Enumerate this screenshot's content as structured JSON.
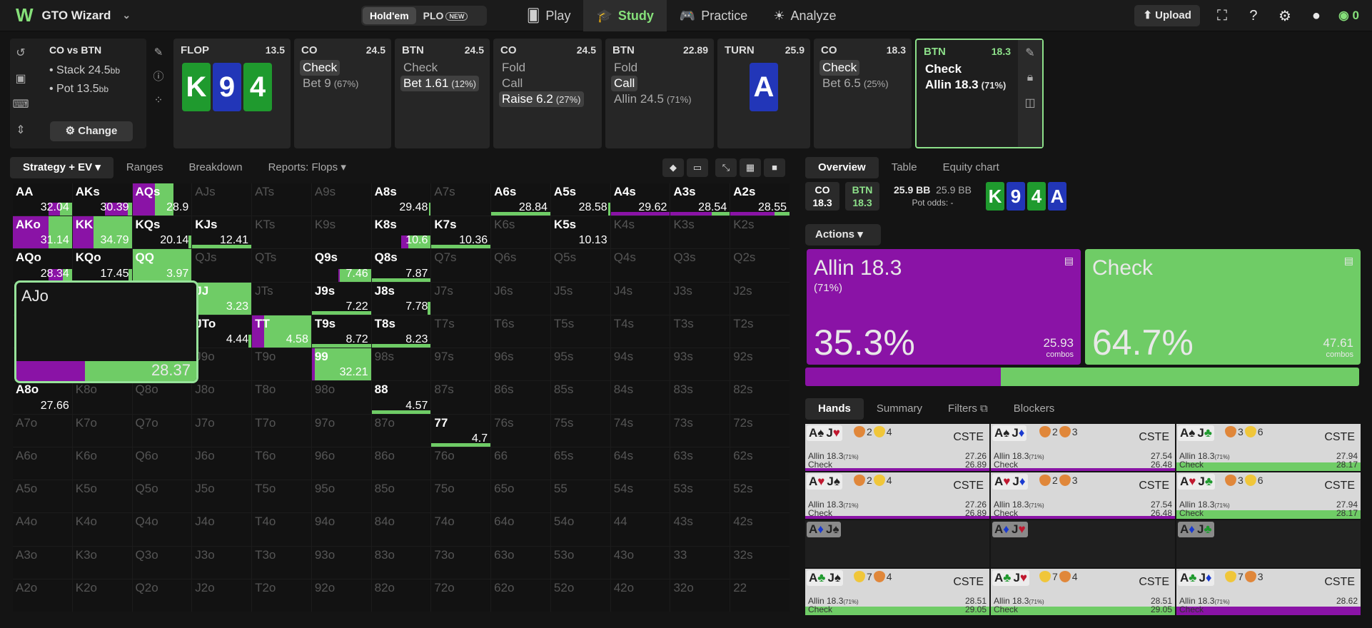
{
  "app": {
    "name": "GTO Wizard",
    "modes": [
      "Hold'em",
      "PLO"
    ],
    "new_badge": "NEW",
    "nav": [
      {
        "label": "Play",
        "icon": "cards-icon"
      },
      {
        "label": "Study",
        "icon": "graduation-icon"
      },
      {
        "label": "Practice",
        "icon": "gamepad-icon"
      },
      {
        "label": "Analyze",
        "icon": "lightbulb-icon"
      }
    ],
    "upload": "Upload",
    "coins": "0"
  },
  "scenario": {
    "title": "CO vs BTN",
    "stack": "Stack 24.5",
    "pot": "Pot 13.5",
    "bb": "bb",
    "change": "Change"
  },
  "tiles": [
    {
      "name": "FLOP",
      "val": "13.5",
      "cards": [
        {
          "r": "K",
          "c": "g"
        },
        {
          "r": "9",
          "c": "b"
        },
        {
          "r": "4",
          "c": "g"
        }
      ]
    },
    {
      "name": "CO",
      "val": "24.5",
      "actions": [
        {
          "t": "Check",
          "p": "",
          "s": "hl"
        },
        {
          "t": "Bet 9",
          "p": "(67%)",
          "s": ""
        }
      ]
    },
    {
      "name": "BTN",
      "val": "24.5",
      "actions": [
        {
          "t": "Check",
          "p": "",
          "s": ""
        },
        {
          "t": "Bet 1.61",
          "p": "(12%)",
          "s": "hl"
        }
      ]
    },
    {
      "name": "CO",
      "val": "24.5",
      "actions": [
        {
          "t": "Fold",
          "p": "",
          "s": ""
        },
        {
          "t": "Call",
          "p": "",
          "s": ""
        },
        {
          "t": "Raise 6.2",
          "p": "(27%)",
          "s": "hl"
        }
      ]
    },
    {
      "name": "BTN",
      "val": "22.89",
      "actions": [
        {
          "t": "Fold",
          "p": "",
          "s": ""
        },
        {
          "t": "Call",
          "p": "",
          "s": "hl"
        },
        {
          "t": "Allin 24.5",
          "p": "(71%)",
          "s": ""
        }
      ]
    },
    {
      "name": "TURN",
      "val": "25.9",
      "cards": [
        {
          "r": "A",
          "c": "b"
        }
      ]
    },
    {
      "name": "CO",
      "val": "18.3",
      "actions": [
        {
          "t": "Check",
          "p": "",
          "s": "hl"
        },
        {
          "t": "Bet 6.5",
          "p": "(25%)",
          "s": ""
        }
      ]
    },
    {
      "name": "BTN",
      "val": "18.3",
      "actions": [
        {
          "t": "Check",
          "p": "",
          "s": "bold"
        },
        {
          "t": "Allin 18.3",
          "p": "(71%)",
          "s": "bold"
        }
      ]
    }
  ],
  "subtabs": [
    "Strategy + EV",
    "Ranges",
    "Breakdown",
    "Reports: Flops"
  ],
  "grid": {
    "cells": [
      [
        "AA",
        "AKs",
        "AQs",
        "AJs",
        "ATs",
        "A9s",
        "A8s",
        "A7s",
        "A6s",
        "A5s",
        "A4s",
        "A3s",
        "A2s"
      ],
      [
        "AKo",
        "KK",
        "KQs",
        "KJs",
        "KTs",
        "K9s",
        "K8s",
        "K7s",
        "K6s",
        "K5s",
        "K4s",
        "K3s",
        "K2s"
      ],
      [
        "AQo",
        "KQo",
        "QQ",
        "QJs",
        "QTs",
        "Q9s",
        "Q8s",
        "Q7s",
        "Q6s",
        "Q5s",
        "Q4s",
        "Q3s",
        "Q2s"
      ],
      [
        "AJo",
        "KJo",
        "QJo",
        "JJ",
        "JTs",
        "J9s",
        "J8s",
        "J7s",
        "J6s",
        "J5s",
        "J4s",
        "J3s",
        "J2s"
      ],
      [
        "ATo",
        "KTo",
        "QTo",
        "JTo",
        "TT",
        "T9s",
        "T8s",
        "T7s",
        "T6s",
        "T5s",
        "T4s",
        "T3s",
        "T2s"
      ],
      [
        "A9o",
        "K9o",
        "Q9o",
        "J9o",
        "T9o",
        "99",
        "98s",
        "97s",
        "96s",
        "95s",
        "94s",
        "93s",
        "92s"
      ],
      [
        "A8o",
        "K8o",
        "Q8o",
        "J8o",
        "T8o",
        "98o",
        "88",
        "87s",
        "86s",
        "85s",
        "84s",
        "83s",
        "82s"
      ],
      [
        "A7o",
        "K7o",
        "Q7o",
        "J7o",
        "T7o",
        "97o",
        "87o",
        "77",
        "76s",
        "75s",
        "74s",
        "73s",
        "72s"
      ],
      [
        "A6o",
        "K6o",
        "Q6o",
        "J6o",
        "T6o",
        "96o",
        "86o",
        "76o",
        "66",
        "65s",
        "64s",
        "63s",
        "62s"
      ],
      [
        "A5o",
        "K5o",
        "Q5o",
        "J5o",
        "T5o",
        "95o",
        "85o",
        "75o",
        "65o",
        "55",
        "54s",
        "53s",
        "52s"
      ],
      [
        "A4o",
        "K4o",
        "Q4o",
        "J4o",
        "T4o",
        "94o",
        "84o",
        "74o",
        "64o",
        "54o",
        "44",
        "43s",
        "42s"
      ],
      [
        "A3o",
        "K3o",
        "Q3o",
        "J3o",
        "T3o",
        "93o",
        "83o",
        "73o",
        "63o",
        "53o",
        "43o",
        "33",
        "32s"
      ],
      [
        "A2o",
        "K2o",
        "Q2o",
        "J2o",
        "T2o",
        "92o",
        "82o",
        "72o",
        "62o",
        "52o",
        "42o",
        "32o",
        "22"
      ]
    ],
    "data": {
      "AA": {
        "ev": "32.04",
        "p": 0.5,
        "h": 0.4
      },
      "AKs": {
        "ev": "30.39",
        "p": 0.85,
        "h": 0.45
      },
      "AQs": {
        "ev": "28.9",
        "p": 0.55,
        "h": 0.7
      },
      "A8s": {
        "ev": "29.48",
        "p": 0,
        "h": 0.03
      },
      "A6s": {
        "ev": "28.84",
        "p": 0,
        "h": 0.12
      },
      "A5s": {
        "ev": "28.58",
        "p": 0,
        "h": 0.03
      },
      "A4s": {
        "ev": "29.62",
        "p": 1,
        "h": 0.12
      },
      "A3s": {
        "ev": "28.54",
        "p": 0.7,
        "h": 0.12
      },
      "A2s": {
        "ev": "28.55",
        "p": 0.75,
        "h": 0.12
      },
      "AKo": {
        "ev": "31.14",
        "p": 0.6,
        "h": 0.9
      },
      "KK": {
        "ev": "34.79",
        "p": 0.35,
        "h": 0.9
      },
      "KQs": {
        "ev": "20.14",
        "p": 0,
        "h": 0.05
      },
      "KJs": {
        "ev": "12.41",
        "p": 0,
        "h": 0.05
      },
      "K8s": {
        "ev": "10.6",
        "p": 0.25,
        "h": 0.5
      },
      "K7s": {
        "ev": "10.36",
        "p": 0,
        "h": 0.5
      },
      "K5s": {
        "ev": "10.13",
        "p": 0,
        "h": 0
      },
      "AQo": {
        "ev": "28.34",
        "p": 0.6,
        "h": 0.4
      },
      "KQo": {
        "ev": "17.45",
        "p": 0,
        "h": 0.05
      },
      "QQ": {
        "ev": "3.97",
        "p": 0,
        "h": 0.9
      },
      "Q9s": {
        "ev": "7.46",
        "p": 0.05,
        "h": 0.55
      },
      "Q8s": {
        "ev": "7.87",
        "p": 0,
        "h": 0.12
      },
      "JJ": {
        "ev": "3.23",
        "p": 0,
        "h": 0.9
      },
      "J9s": {
        "ev": "7.22",
        "p": 0,
        "h": 0.12
      },
      "J8s": {
        "ev": "7.78",
        "p": 0,
        "h": 0.05
      },
      "JTo": {
        "ev": "4.44",
        "p": 0,
        "h": 0.05
      },
      "TT": {
        "ev": "4.58",
        "p": 0.2,
        "h": 0.9
      },
      "T9s": {
        "ev": "8.72",
        "p": 0,
        "h": 0.12
      },
      "T8s": {
        "ev": "8.23",
        "p": 0,
        "h": 0.12
      },
      "99": {
        "ev": "32.21",
        "p": 0.05,
        "h": 0.9
      },
      "A8o": {
        "ev": "27.66",
        "p": 0,
        "h": 0
      },
      "88": {
        "ev": "4.57",
        "p": 0,
        "h": 0.15
      },
      "77": {
        "ev": "4.7",
        "p": 0,
        "h": 0.05
      }
    },
    "uline": [
      "A6s",
      "A4s",
      "A3s",
      "A2s",
      "Q8s",
      "J9s",
      "T9s",
      "T8s",
      "88",
      "77",
      "KJs",
      "K7s"
    ],
    "zoom": {
      "name": "AJo",
      "ev": "28.37",
      "p": 0.38
    }
  },
  "rtabs": [
    "Overview",
    "Table",
    "Equity chart"
  ],
  "overview": {
    "co": "CO",
    "co_val": "18.3",
    "btn": "BTN",
    "btn_val": "18.3",
    "pot": "25.9 BB",
    "pot2": "25.9 BB",
    "pot_odds": "Pot odds:",
    "pot_odds_val": "-",
    "board": [
      {
        "r": "K",
        "c": "g"
      },
      {
        "r": "9",
        "c": "b"
      },
      {
        "r": "4",
        "c": "g"
      },
      {
        "r": "A",
        "c": "b"
      }
    ]
  },
  "actions_label": "Actions",
  "action_boxes": [
    {
      "name": "Allin 18.3",
      "sub": "(71%)",
      "pct": "35.3%",
      "combos": "25.93",
      "unit": "combos",
      "color": "#8a13a6",
      "freq": 0.353
    },
    {
      "name": "Check",
      "sub": "",
      "pct": "64.7%",
      "combos": "47.61",
      "unit": "combos",
      "color": "#6fcc66",
      "freq": 0.647
    }
  ],
  "htabs": [
    "Hands",
    "Summary",
    "Filters",
    "Blockers"
  ],
  "hands": [
    {
      "c1": "A",
      "s1": "♠",
      "k1": "b",
      "c2": "J",
      "s2": "♥",
      "k2": "r",
      "b1": "2",
      "b2": "4",
      "t1": "o",
      "t2": "y",
      "label": "CSTE",
      "l1": "Allin 18.3",
      "l1p": "(71%)",
      "v1": "27.26",
      "l2": "Check",
      "v2": "26.89",
      "bar": "p"
    },
    {
      "c1": "A",
      "s1": "♠",
      "k1": "b",
      "c2": "J",
      "s2": "♦",
      "k2": "u",
      "b1": "2",
      "b2": "3",
      "t1": "o",
      "t2": "o",
      "label": "CSTE",
      "l1": "Allin 18.3",
      "l1p": "(71%)",
      "v1": "27.54",
      "l2": "Check",
      "v2": "26.48",
      "bar": "p"
    },
    {
      "c1": "A",
      "s1": "♠",
      "k1": "b",
      "c2": "J",
      "s2": "♣",
      "k2": "g",
      "b1": "3",
      "b2": "6",
      "t1": "o",
      "t2": "y",
      "label": "CSTE",
      "l1": "Allin 18.3",
      "l1p": "(71%)",
      "v1": "27.94",
      "l2": "Check",
      "v2": "28.17",
      "bar": "g"
    },
    {
      "c1": "A",
      "s1": "♥",
      "k1": "r",
      "c2": "J",
      "s2": "♠",
      "k2": "b",
      "b1": "2",
      "b2": "4",
      "t1": "o",
      "t2": "y",
      "label": "CSTE",
      "l1": "Allin 18.3",
      "l1p": "(71%)",
      "v1": "27.26",
      "l2": "Check",
      "v2": "26.89",
      "bar": "p"
    },
    {
      "c1": "A",
      "s1": "♥",
      "k1": "r",
      "c2": "J",
      "s2": "♦",
      "k2": "u",
      "b1": "2",
      "b2": "3",
      "t1": "o",
      "t2": "o",
      "label": "CSTE",
      "l1": "Allin 18.3",
      "l1p": "(71%)",
      "v1": "27.54",
      "l2": "Check",
      "v2": "26.48",
      "bar": "p"
    },
    {
      "c1": "A",
      "s1": "♥",
      "k1": "r",
      "c2": "J",
      "s2": "♣",
      "k2": "g",
      "b1": "3",
      "b2": "6",
      "t1": "o",
      "t2": "y",
      "label": "CSTE",
      "l1": "Allin 18.3",
      "l1p": "(71%)",
      "v1": "27.94",
      "l2": "Check",
      "v2": "28.17",
      "bar": "g"
    },
    {
      "c1": "A",
      "s1": "♦",
      "k1": "u",
      "c2": "J",
      "s2": "♠",
      "k2": "b",
      "empty": true
    },
    {
      "c1": "A",
      "s1": "♦",
      "k1": "u",
      "c2": "J",
      "s2": "♥",
      "k2": "r",
      "empty": true
    },
    {
      "c1": "A",
      "s1": "♦",
      "k1": "u",
      "c2": "J",
      "s2": "♣",
      "k2": "g",
      "empty": true
    },
    {
      "c1": "A",
      "s1": "♣",
      "k1": "g",
      "c2": "J",
      "s2": "♠",
      "k2": "b",
      "b1": "7",
      "b2": "4",
      "t1": "y",
      "t2": "o",
      "label": "CSTE",
      "l1": "Allin 18.3",
      "l1p": "(71%)",
      "v1": "28.51",
      "l2": "Check",
      "v2": "29.05",
      "bar": "g"
    },
    {
      "c1": "A",
      "s1": "♣",
      "k1": "g",
      "c2": "J",
      "s2": "♥",
      "k2": "r",
      "b1": "7",
      "b2": "4",
      "t1": "y",
      "t2": "o",
      "label": "CSTE",
      "l1": "Allin 18.3",
      "l1p": "(71%)",
      "v1": "28.51",
      "l2": "Check",
      "v2": "29.05",
      "bar": "g"
    },
    {
      "c1": "A",
      "s1": "♣",
      "k1": "g",
      "c2": "J",
      "s2": "♦",
      "k2": "u",
      "b1": "7",
      "b2": "3",
      "t1": "y",
      "t2": "o",
      "label": "CSTE",
      "l1": "Allin 18.3",
      "l1p": "(71%)",
      "v1": "28.62",
      "l2": "Check",
      "v2": "",
      "bar": "pb"
    }
  ]
}
